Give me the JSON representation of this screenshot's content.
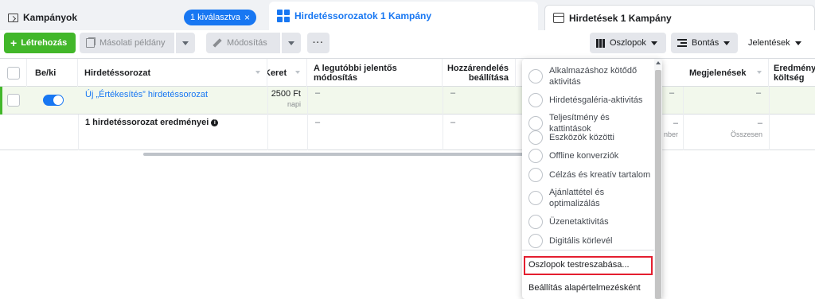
{
  "tabs": {
    "campaigns": {
      "label": "Kampányok",
      "badge": "1 kiválasztva",
      "badge_close": "×"
    },
    "adsets": {
      "label": "Hirdetéssorozatok 1 Kampány"
    },
    "ads": {
      "label": "Hirdetések 1 Kampány"
    }
  },
  "toolbar": {
    "create_label": "Létrehozás",
    "create_plus": "+",
    "duplicate_label": "Másolati példány",
    "edit_label": "Módosítás",
    "more_label": "···",
    "columns_label": "Oszlopok",
    "breakdown_label": "Bontás",
    "reports_label": "Jelentések"
  },
  "table": {
    "headers": {
      "onoff": "Be/ki",
      "adset": "Hirdetéssorozat",
      "budget": "Keret",
      "last_change": "A legutóbbi jelentős módosítás",
      "attribution": "Hozzárendelés beállítása",
      "impressions": "Megjelenések",
      "cost_result": "Eredmény költség"
    },
    "row": {
      "name": "Új „Értékesítés” hirdetéssorozat",
      "budget": "2500 Ft",
      "budget_sub": "napi",
      "last_change": "–",
      "attribution": "–",
      "col_a": "–",
      "impressions": "–"
    },
    "summary": {
      "label": "1 hirdetéssorozat eredményei",
      "last_change": "–",
      "attribution": "–",
      "col_a": "–",
      "col_a_sub": "nber",
      "impressions": "–",
      "impressions_sub": "Összesen"
    }
  },
  "columns_menu": {
    "items": [
      "Alkalmazáshoz kötődő aktivitás",
      "Hirdetésgaléria-aktivitás",
      "Teljesítmény és kattintások",
      "Eszközök közötti",
      "Offline konverziók",
      "Célzás és kreatív tartalom",
      "Ajánlattétel és optimalizálás",
      "Üzenetaktivitás",
      "Digitális körlevél"
    ],
    "customize": "Oszlopok testreszabása...",
    "set_default": "Beállítás alapértelmezésként"
  },
  "colors": {
    "accent": "#1877f2",
    "create": "#42b72a",
    "highlight": "#e41e2f",
    "row_bg": "#f2f8ec"
  }
}
